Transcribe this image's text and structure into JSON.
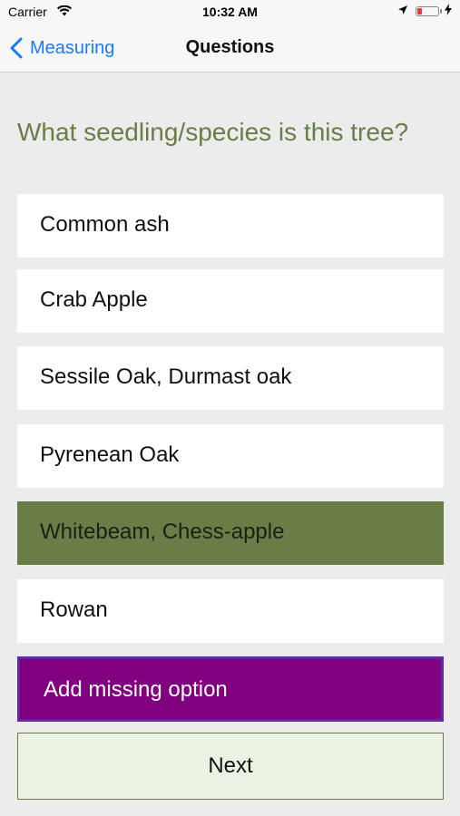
{
  "status_bar": {
    "carrier": "Carrier",
    "time": "10:32 AM",
    "battery_color": "#e53935"
  },
  "nav": {
    "back_label": "Measuring",
    "title": "Questions",
    "accent_color": "#1a7cf5"
  },
  "question": {
    "text": "What seedling/species is this tree?",
    "color": "#6a7d47"
  },
  "options": [
    {
      "label": "Common ash",
      "selected": false
    },
    {
      "label": "Crab Apple",
      "selected": false
    },
    {
      "label": "Sessile Oak, Durmast oak",
      "selected": false
    },
    {
      "label": "Pyrenean Oak",
      "selected": false
    },
    {
      "label": "Whitebeam, Chess-apple",
      "selected": true
    },
    {
      "label": "Rowan",
      "selected": false
    }
  ],
  "add_option": {
    "label": "Add missing option",
    "color": "#800080"
  },
  "next": {
    "label": "Next"
  }
}
